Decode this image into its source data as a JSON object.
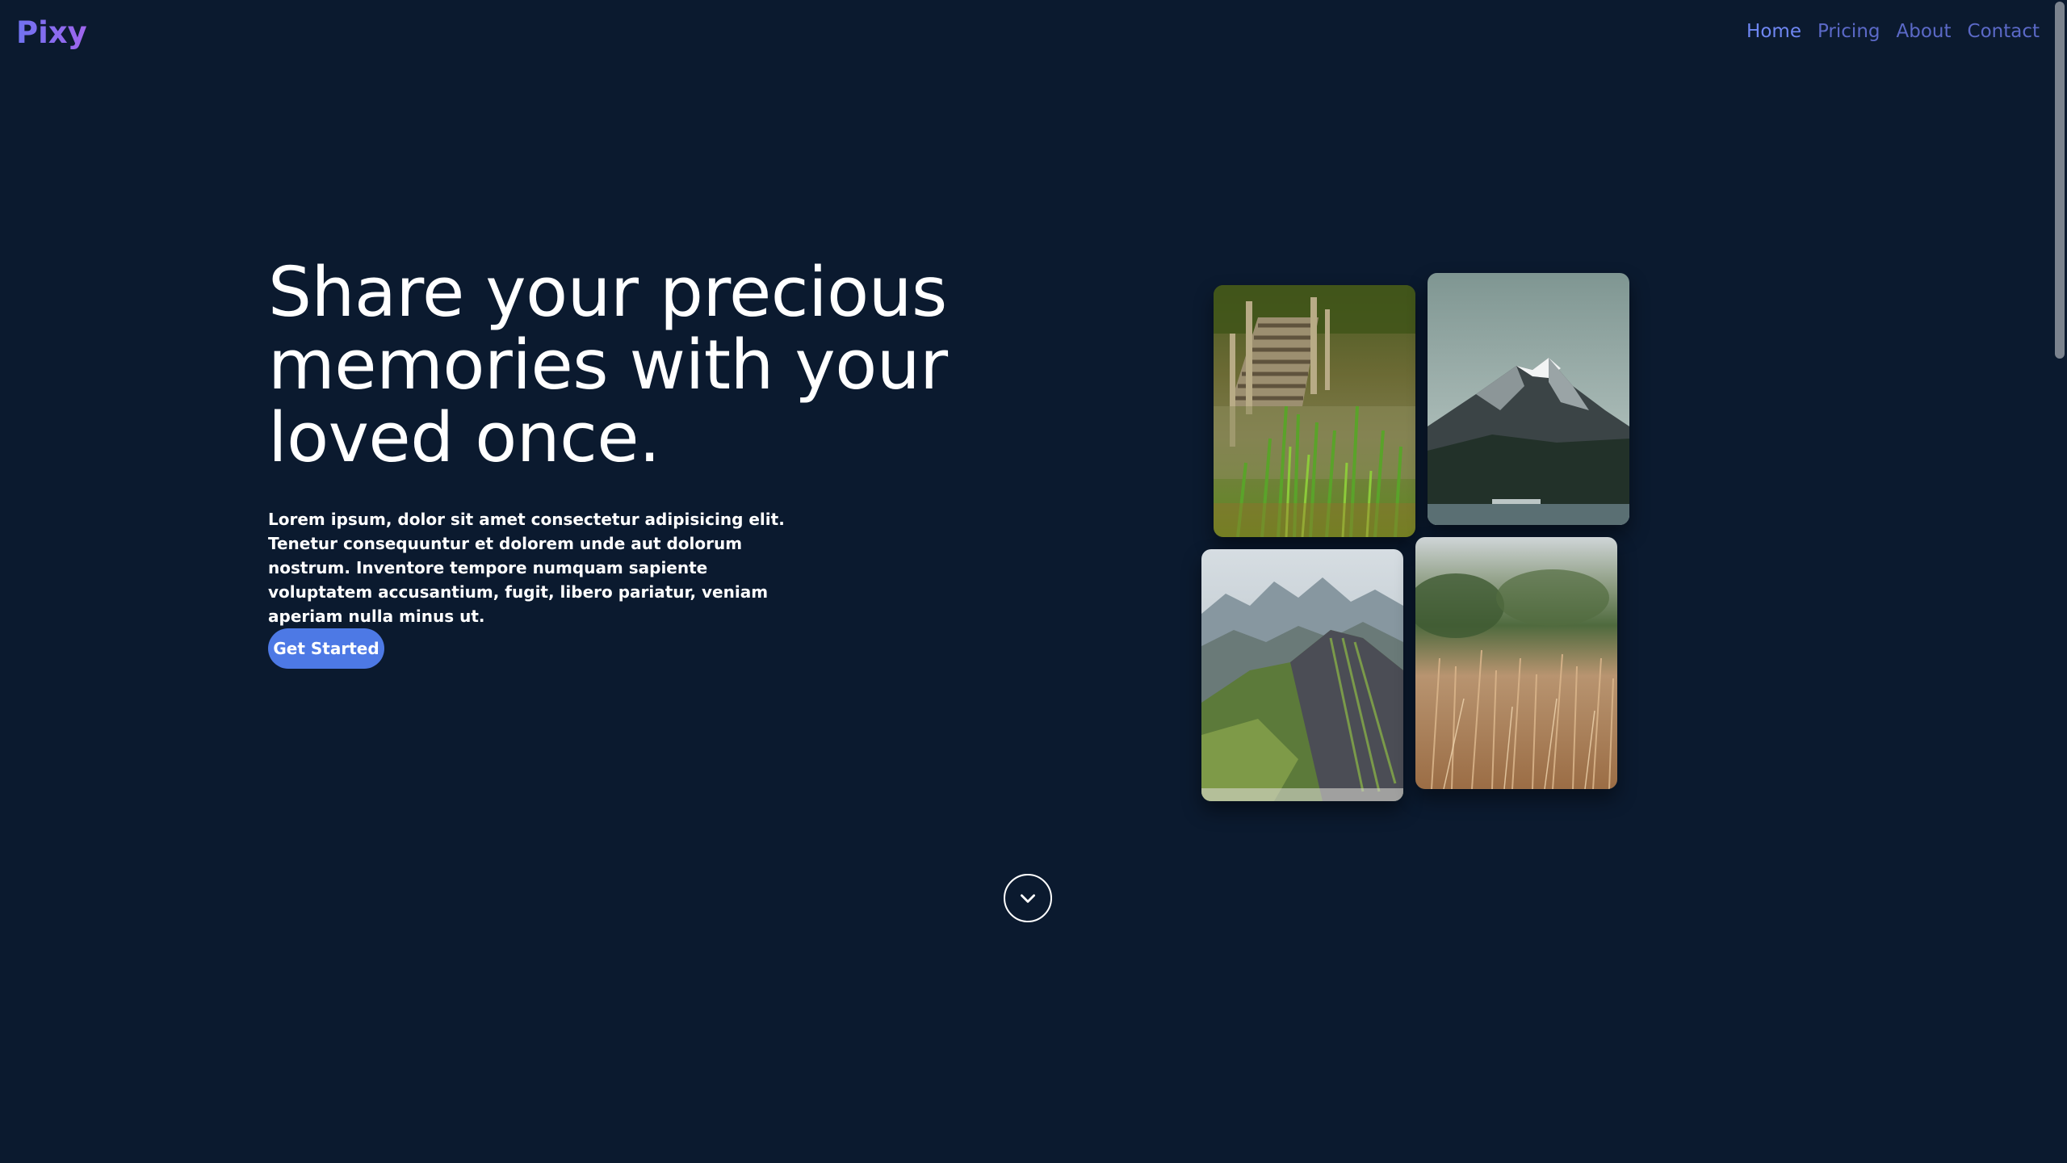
{
  "header": {
    "brand": "Pixy",
    "nav": [
      {
        "label": "Home",
        "active": true
      },
      {
        "label": "Pricing",
        "active": false
      },
      {
        "label": "About",
        "active": false
      },
      {
        "label": "Contact",
        "active": false
      }
    ]
  },
  "hero": {
    "title": "Share your precious memories with your loved once.",
    "description": "Lorem ipsum, dolor sit amet consectetur adipisicing elit. Tenetur consequuntur et dolorem unde aut dolorum nostrum. Inventore tempore numquam sapiente voluptatem accusantium, fugit, libero pariatur, veniam aperiam nulla minus ut.",
    "cta_label": "Get Started"
  },
  "gallery": [
    {
      "subject": "wooden-pier-in-reeds"
    },
    {
      "subject": "snowy-mountain-lake"
    },
    {
      "subject": "green-mountain-ridges"
    },
    {
      "subject": "dry-grass-field"
    }
  ],
  "scroll_down_icon": "chevron-down-icon",
  "colors": {
    "background": "#0b1a2f",
    "brand_start": "#6f72f0",
    "brand_end": "#a065ee",
    "nav_active": "#6f87f3",
    "nav": "#5b69c7",
    "button": "#4d79e5"
  }
}
